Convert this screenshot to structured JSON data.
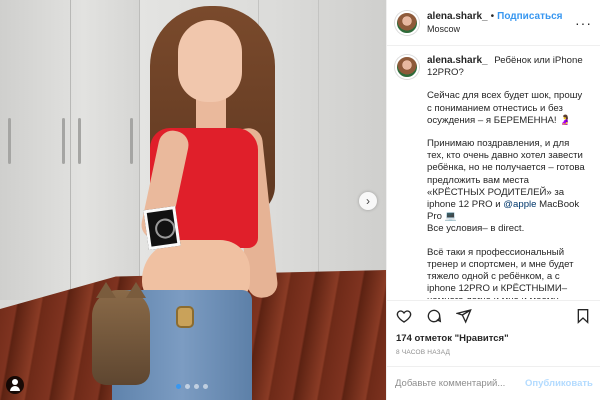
{
  "post": {
    "username": "alena.shark_",
    "follow_bullet": "•",
    "follow_label": "Подписаться",
    "location": "Moscow",
    "more_label": "···",
    "next_label": "›"
  },
  "caption": {
    "username": "alena.shark_",
    "title": "Ребёнок или iPhone 12PRO?",
    "paragraph1": "Сейчас для всех будет шок, прошу с пониманием отнестись и без осуждения – я БЕРЕМЕННА! 🤰",
    "paragraph2_part1": "Принимаю поздравления, и для тех, кто очень давно хотел завести ребёнка, но не получается – готова предложить вам места «КРЁСТНЫХ РОДИТЕЛЕЙ» за iphone 12 PRO и ",
    "paragraph2_mention": "@apple",
    "paragraph2_part2": " MacBook Pro 💻\nВсе условия– в direct.",
    "paragraph3": "Всё таки я профессиональный тренер и спортсмен, и мне будет тяжело одной с ребёнком, а с iphone 12PRO и КРЁСТНЫМИ– немного легче и мне и моему ребёнку! 😇"
  },
  "actions": {
    "like_icon": "heart-icon",
    "comment_icon": "comment-icon",
    "share_icon": "share-icon",
    "save_icon": "bookmark-icon"
  },
  "stats": {
    "likes_text": "174 отметок \"Нравится\"",
    "time_text": "8 ЧАСОВ НАЗАД"
  },
  "comment": {
    "placeholder": "Добавьте комментарий...",
    "publish_label": "Опубликовать"
  },
  "carousel": {
    "slide_count": 4,
    "active_index": 0
  },
  "colors": {
    "accent": "#3897f0",
    "publish_disabled": "#b3dbff",
    "text": "#262626",
    "muted": "#8e8e8e"
  }
}
